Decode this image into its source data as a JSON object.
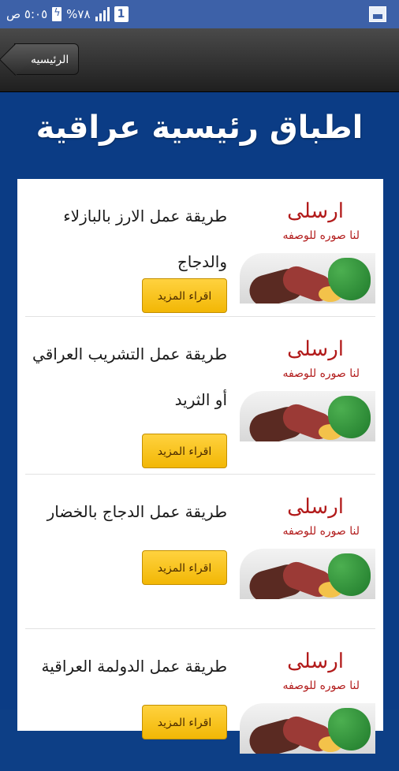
{
  "status_bar": {
    "time": "٥:٠٥ ص",
    "battery": "%٧٨",
    "sim": "1"
  },
  "toolbar": {
    "back_label": "الرئيسيه"
  },
  "page": {
    "title": "اطباق رئيسية عراقية"
  },
  "thumb": {
    "line1": "ارسلى",
    "line2": "لنا صوره للوصفه"
  },
  "recipes": [
    {
      "title": "طريقة عمل الارز بالبازلاء والدجاج",
      "button": "اقراء المزيد"
    },
    {
      "title": "طريقة عمل التشريب العراقي أو الثريد",
      "button": "اقراء المزيد"
    },
    {
      "title": "طريقة عمل الدجاج بالخضار",
      "button": "اقراء المزيد"
    },
    {
      "title": "طريقة عمل الدولمة العراقية",
      "button": "اقراء المزيد"
    }
  ]
}
